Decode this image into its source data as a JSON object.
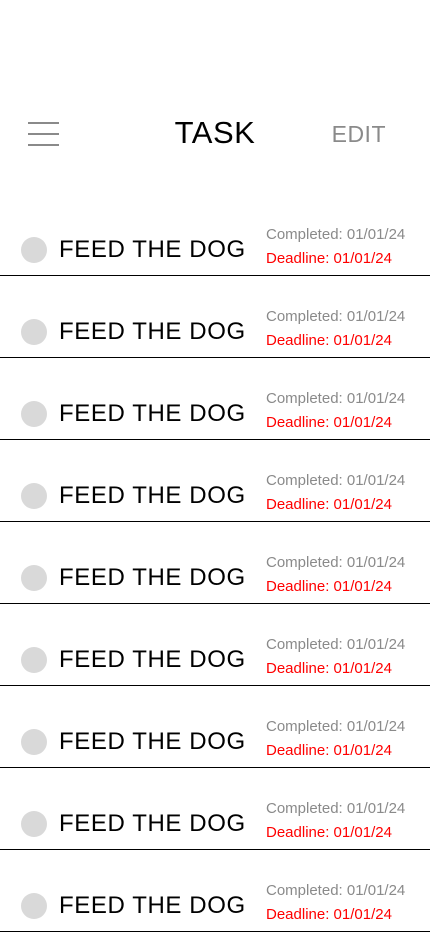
{
  "header": {
    "menu_icon": "hamburger-menu-icon",
    "title": "TASK",
    "edit_label": "EDIT"
  },
  "colors": {
    "muted": "#8a8a8a",
    "deadline": "#ff0000",
    "checkbox": "#d9d9d9",
    "divider": "#000000"
  },
  "tasks": [
    {
      "name": "FEED THE DOG",
      "completed": "Completed: 01/01/24",
      "deadline": "Deadline: 01/01/24"
    },
    {
      "name": "FEED THE DOG",
      "completed": "Completed: 01/01/24",
      "deadline": "Deadline: 01/01/24"
    },
    {
      "name": "FEED THE DOG",
      "completed": "Completed: 01/01/24",
      "deadline": "Deadline: 01/01/24"
    },
    {
      "name": "FEED THE DOG",
      "completed": "Completed: 01/01/24",
      "deadline": "Deadline: 01/01/24"
    },
    {
      "name": "FEED THE DOG",
      "completed": "Completed: 01/01/24",
      "deadline": "Deadline: 01/01/24"
    },
    {
      "name": "FEED THE DOG",
      "completed": "Completed: 01/01/24",
      "deadline": "Deadline: 01/01/24"
    },
    {
      "name": "FEED THE DOG",
      "completed": "Completed: 01/01/24",
      "deadline": "Deadline: 01/01/24"
    },
    {
      "name": "FEED THE DOG",
      "completed": "Completed: 01/01/24",
      "deadline": "Deadline: 01/01/24"
    },
    {
      "name": "FEED THE DOG",
      "completed": "Completed: 01/01/24",
      "deadline": "Deadline: 01/01/24"
    }
  ]
}
